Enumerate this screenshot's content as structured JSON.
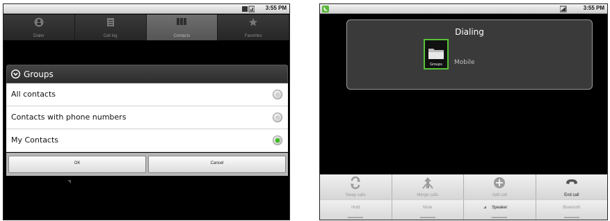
{
  "left_screen": {
    "status_bar": {
      "time": "3:55 PM"
    },
    "tabs": [
      {
        "label": "Dialer",
        "icon": "person-icon"
      },
      {
        "label": "Call log",
        "icon": "call-log-icon"
      },
      {
        "label": "Contacts",
        "icon": "contacts-icon",
        "active": true
      },
      {
        "label": "Favorites",
        "icon": "star-icon"
      }
    ],
    "groups_dialog": {
      "title": "Groups",
      "options": [
        {
          "label": "All contacts",
          "checked": false
        },
        {
          "label": "Contacts with phone numbers",
          "checked": false
        },
        {
          "label": "My Contacts",
          "checked": true
        }
      ],
      "ok_label": "OK",
      "cancel_label": "Cancel"
    }
  },
  "right_screen": {
    "status_bar": {
      "time": "3:55 PM"
    },
    "call_card": {
      "status": "Dialing",
      "photo_label": "Groups",
      "phone_type": "Mobile"
    },
    "call_buttons_top": [
      {
        "label": "Swap calls",
        "icon": "swap-calls-icon",
        "enabled": false
      },
      {
        "label": "Merge calls",
        "icon": "merge-calls-icon",
        "enabled": false
      },
      {
        "label": "Add call",
        "icon": "add-call-icon",
        "enabled": false
      },
      {
        "label": "End call",
        "icon": "end-call-icon",
        "enabled": true
      }
    ],
    "call_buttons_bottom": [
      {
        "label": "Hold",
        "enabled": false
      },
      {
        "label": "Mute",
        "enabled": false
      },
      {
        "label": "Speaker",
        "enabled": true
      },
      {
        "label": "Bluetooth",
        "enabled": false
      }
    ],
    "colors": {
      "accent_green": "#57c238",
      "radio_checked": "#3cbd1e"
    }
  }
}
